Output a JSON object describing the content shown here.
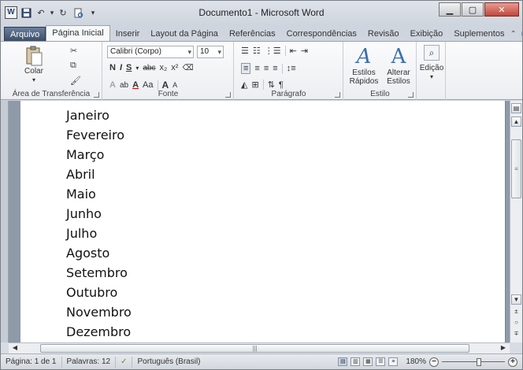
{
  "window": {
    "title": "Documento1 - Microsoft Word",
    "app_icon_letter": "W"
  },
  "qat": {
    "save_icon": "save-icon",
    "undo_icon": "undo-icon",
    "redo_icon": "redo-icon",
    "print_preview_icon": "print-preview-icon",
    "customize_icon": "qat-dropdown-icon"
  },
  "tabs": [
    {
      "label": "Arquivo"
    },
    {
      "label": "Página Inicial"
    },
    {
      "label": "Inserir"
    },
    {
      "label": "Layout da Página"
    },
    {
      "label": "Referências"
    },
    {
      "label": "Correspondências"
    },
    {
      "label": "Revisão"
    },
    {
      "label": "Exibição"
    },
    {
      "label": "Suplementos"
    }
  ],
  "ribbon": {
    "clipboard": {
      "label": "Área de Transferência",
      "paste": "Colar"
    },
    "font": {
      "label": "Fonte",
      "family": "Calibri (Corpo)",
      "size": "10",
      "bold": "N",
      "italic": "I",
      "underline": "S",
      "strike": "abc",
      "subscript": "x₂",
      "superscript": "x²",
      "case": "Aa",
      "grow": "A",
      "shrink": "A"
    },
    "paragraph": {
      "label": "Parágrafo",
      "pilcrow": "¶"
    },
    "styles": {
      "label": "Estilo",
      "quick_styles": "Estilos Rápidos",
      "change_styles": "Alterar Estilos"
    },
    "editing": {
      "label": "Edição"
    }
  },
  "document": {
    "lines": [
      "Janeiro",
      "Fevereiro",
      "Março",
      "Abril",
      "Maio",
      "Junho",
      "Julho",
      "Agosto",
      "Setembro",
      "Outubro",
      "Novembro",
      "Dezembro"
    ]
  },
  "statusbar": {
    "page": "Página: 1 de 1",
    "words": "Palavras: 12",
    "language": "Português (Brasil)",
    "zoom": "180%",
    "zoom_level_percent": 180
  }
}
